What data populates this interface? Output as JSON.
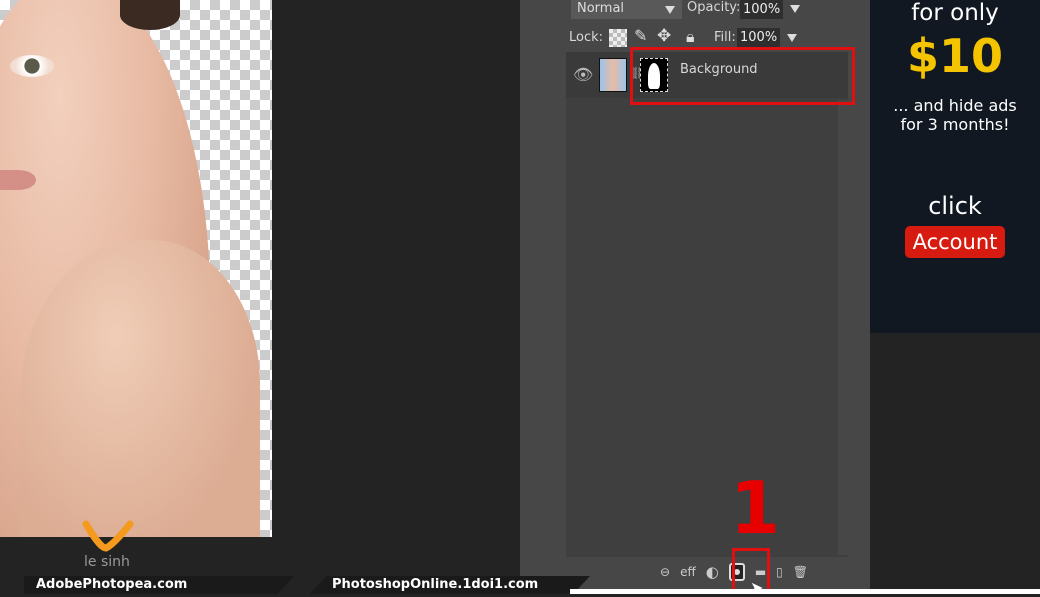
{
  "layers_panel": {
    "blend_mode": "Normal",
    "opacity_label": "Opacity:",
    "opacity_value": "100%",
    "lock_label": "Lock:",
    "fill_label": "Fill:",
    "fill_value": "100%",
    "layers": [
      {
        "name": "Background",
        "visible": true,
        "has_mask": true
      }
    ],
    "footer_buttons": [
      "link-icon",
      "eff",
      "adjustment-icon",
      "mask-icon",
      "folder-icon",
      "new-layer-icon",
      "trash-icon"
    ],
    "eff_label": "eff"
  },
  "annotation": {
    "step_number": "1",
    "highlight_color": "#e01010"
  },
  "ad": {
    "line1": "for only",
    "price": "$10",
    "line2": "... and hide ads",
    "line3": "for 3 months!",
    "click": "click",
    "button": "Account",
    "price_color": "#f5c400",
    "button_color": "#d81b10"
  },
  "watermark": {
    "logo_text": "le sinh"
  },
  "footer": {
    "left": "AdobePhotopea.com",
    "right": "PhotoshopOnline.1doi1.com"
  }
}
